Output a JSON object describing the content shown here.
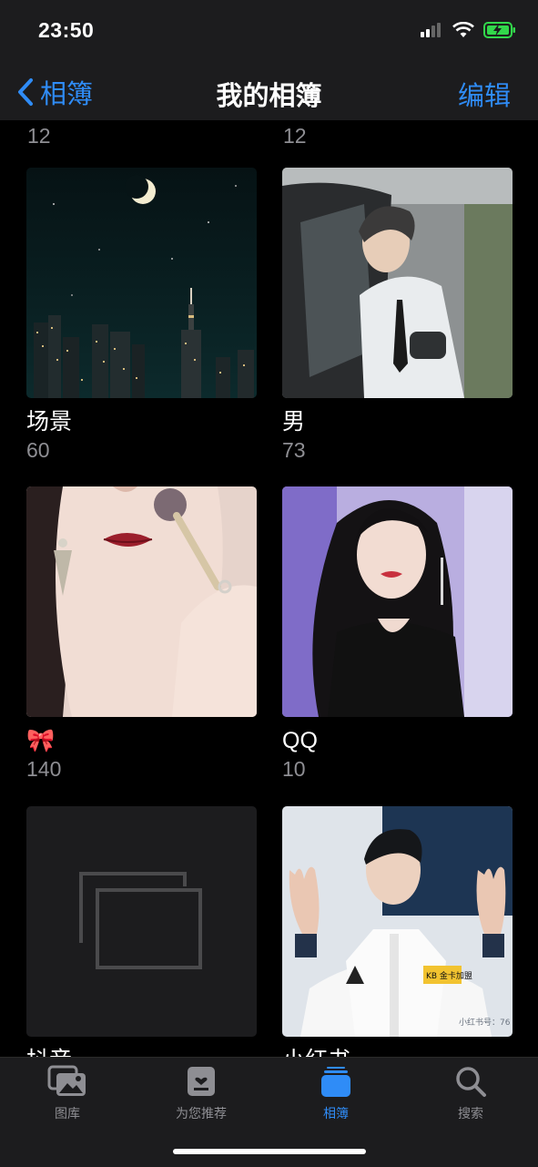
{
  "status": {
    "time": "23:50"
  },
  "nav": {
    "back_label": "相簿",
    "title": "我的相簿",
    "edit_label": "编辑"
  },
  "top_counts": [
    "12",
    "12"
  ],
  "albums": [
    {
      "title": "场景",
      "count": "60"
    },
    {
      "title": "男",
      "count": "73"
    },
    {
      "title": "🎀",
      "count": "140"
    },
    {
      "title": "QQ",
      "count": "10"
    },
    {
      "title": "抖音",
      "count": ""
    },
    {
      "title": "小红书",
      "count": ""
    }
  ],
  "watermark": "小红书号：76",
  "jacket_badge": "KB 金卡加盟",
  "tabs": [
    {
      "label": "图库",
      "icon": "photos-icon"
    },
    {
      "label": "为您推荐",
      "icon": "for-you-icon"
    },
    {
      "label": "相簿",
      "icon": "albums-icon"
    },
    {
      "label": "搜索",
      "icon": "search-icon"
    }
  ],
  "colors": {
    "accent": "#2f8cf7",
    "bar": "#1c1c1e",
    "secondary": "#8e8e93",
    "battery": "#32d74b"
  }
}
